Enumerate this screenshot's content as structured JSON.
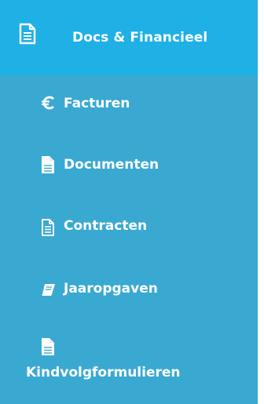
{
  "sidebar": {
    "header": {
      "label": "Docs & Financieel",
      "icon": "document-icon"
    },
    "items": [
      {
        "label": "Facturen",
        "icon": "euro-icon"
      },
      {
        "label": "Documenten",
        "icon": "file-icon"
      },
      {
        "label": "Contracten",
        "icon": "contract-icon"
      },
      {
        "label": "Jaaropgaven",
        "icon": "book-icon"
      },
      {
        "label": "Kindvolgformulieren",
        "icon": "file-icon"
      }
    ]
  },
  "colors": {
    "header_bg": "#1fb0e6",
    "menu_bg": "#39a9d2",
    "text": "#ffffff"
  }
}
